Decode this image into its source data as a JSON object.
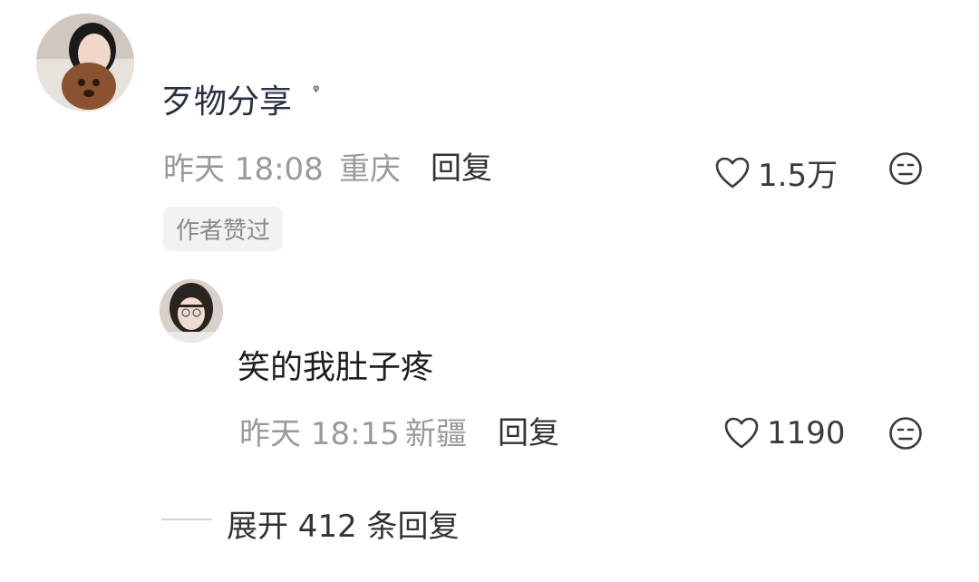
{
  "comments": [
    {
      "text": "歹物分享",
      "search_mark": "ᵠ",
      "time": "昨天 18:08",
      "location": "重庆",
      "reply_label": "回复",
      "likes": "1.5万",
      "badge": "作者赞过"
    },
    {
      "text": "笑的我肚子疼",
      "time": "昨天 18:15",
      "location": "新疆",
      "reply_label": "回复",
      "likes": "1190"
    }
  ],
  "expand": {
    "label": "展开 412 条回复"
  },
  "icons": {
    "like": "heart-outline-icon",
    "emoji": "neutral-face-icon"
  },
  "colors": {
    "meta": "#9a9a9a",
    "text": "#1e1e1e",
    "badge_bg": "#f2f2f2"
  }
}
